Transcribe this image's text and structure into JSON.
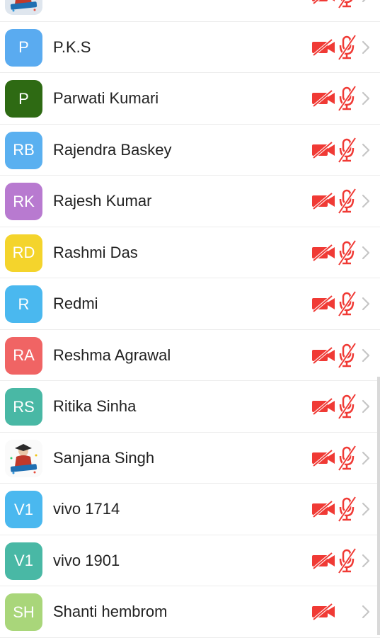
{
  "colors": {
    "status_red": "#f03a35",
    "chevron": "#c6c6c6",
    "name_text": "#222222"
  },
  "participants": [
    {
      "initials": "",
      "name": "",
      "avatar_type": "photo",
      "avatar_color": "#dfe6ee",
      "video": "off",
      "audio": "off"
    },
    {
      "initials": "P",
      "name": "P.K.S",
      "avatar_type": "initials",
      "avatar_color": "#5aabf0",
      "video": "off",
      "audio": "off"
    },
    {
      "initials": "P",
      "name": "Parwati Kumari",
      "avatar_type": "initials",
      "avatar_color": "#2e6a13",
      "video": "off",
      "audio": "off"
    },
    {
      "initials": "RB",
      "name": "Rajendra Baskey",
      "avatar_type": "initials",
      "avatar_color": "#5ab0f0",
      "video": "off",
      "audio": "off"
    },
    {
      "initials": "RK",
      "name": "Rajesh Kumar",
      "avatar_type": "initials",
      "avatar_color": "#b87ad0",
      "video": "off",
      "audio": "off"
    },
    {
      "initials": "RD",
      "name": "Rashmi Das",
      "avatar_type": "initials",
      "avatar_color": "#f4d42c",
      "video": "off",
      "audio": "off"
    },
    {
      "initials": "R",
      "name": "Redmi",
      "avatar_type": "initials",
      "avatar_color": "#4ab8ef",
      "video": "off",
      "audio": "off"
    },
    {
      "initials": "RA",
      "name": "Reshma Agrawal",
      "avatar_type": "initials",
      "avatar_color": "#f06464",
      "video": "off",
      "audio": "off"
    },
    {
      "initials": "RS",
      "name": "Ritika Sinha",
      "avatar_type": "initials",
      "avatar_color": "#49b8a5",
      "video": "off",
      "audio": "off"
    },
    {
      "initials": "",
      "name": "Sanjana Singh",
      "avatar_type": "photo",
      "avatar_color": "#fafafa",
      "video": "off",
      "audio": "off"
    },
    {
      "initials": "V1",
      "name": "vivo 1714",
      "avatar_type": "initials",
      "avatar_color": "#4ab8ef",
      "video": "off",
      "audio": "off"
    },
    {
      "initials": "V1",
      "name": "vivo 1901",
      "avatar_type": "initials",
      "avatar_color": "#49b8a5",
      "video": "off",
      "audio": "off"
    },
    {
      "initials": "SH",
      "name": "Shanti hembrom",
      "avatar_type": "initials",
      "avatar_color": "#a9d67a",
      "video": "off",
      "audio": "none"
    }
  ]
}
